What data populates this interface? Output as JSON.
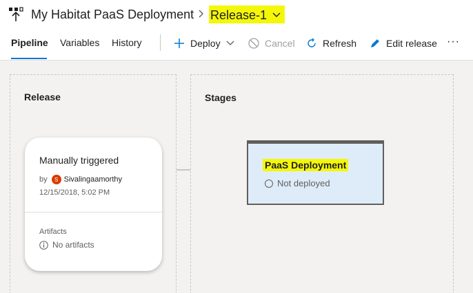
{
  "header": {
    "pipeline_title": "My Habitat PaaS Deployment",
    "release_name": "Release-1"
  },
  "tabs": [
    {
      "label": "Pipeline",
      "active": true
    },
    {
      "label": "Variables",
      "active": false
    },
    {
      "label": "History",
      "active": false
    }
  ],
  "actions": {
    "deploy": "Deploy",
    "cancel": "Cancel",
    "refresh": "Refresh",
    "edit_release": "Edit release",
    "more": "···"
  },
  "release_panel": {
    "title": "Release",
    "card": {
      "trigger": "Manually triggered",
      "by_label": "by",
      "avatar_initial": "S",
      "user": "Sivalingaamorthy",
      "datetime": "12/15/2018, 5:02 PM",
      "artifacts_label": "Artifacts",
      "artifacts_value": "No artifacts"
    }
  },
  "stages_panel": {
    "title": "Stages",
    "stages": [
      {
        "name": "PaaS Deployment",
        "status": "Not deployed"
      }
    ]
  },
  "colors": {
    "accent": "#0078d4",
    "highlight": "#f4f70a",
    "stage_bg": "#deecf9",
    "avatar": "#d83b01"
  }
}
